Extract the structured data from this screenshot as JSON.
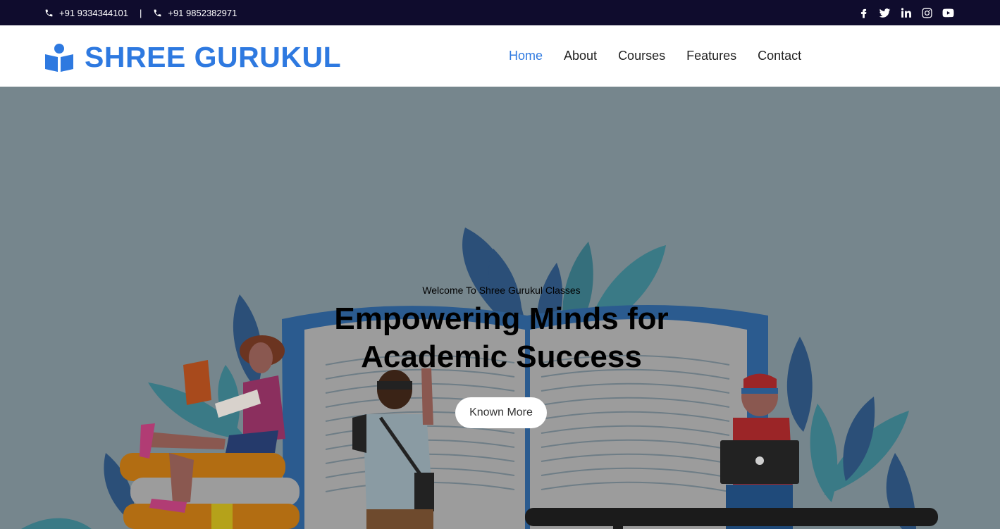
{
  "topbar": {
    "phone1": "+91 9334344101",
    "separator": "|",
    "phone2": "+91 9852382971",
    "socials": [
      "facebook-icon",
      "twitter-icon",
      "linkedin-icon",
      "instagram-icon",
      "youtube-icon"
    ]
  },
  "header": {
    "brand": "SHREE GURUKUL",
    "nav": [
      "Home",
      "About",
      "Courses",
      "Features",
      "Contact"
    ],
    "active_nav": "Home"
  },
  "hero": {
    "eyebrow": "Welcome To Shree Gurukul Classes",
    "headline_line1": "Empowering Minds for",
    "headline_line2": "Academic Success",
    "cta_label": "Known More"
  },
  "colors": {
    "topbar_bg": "#0f0c2d",
    "brand_blue": "#2e79e0",
    "hero_bg": "#76868d"
  }
}
